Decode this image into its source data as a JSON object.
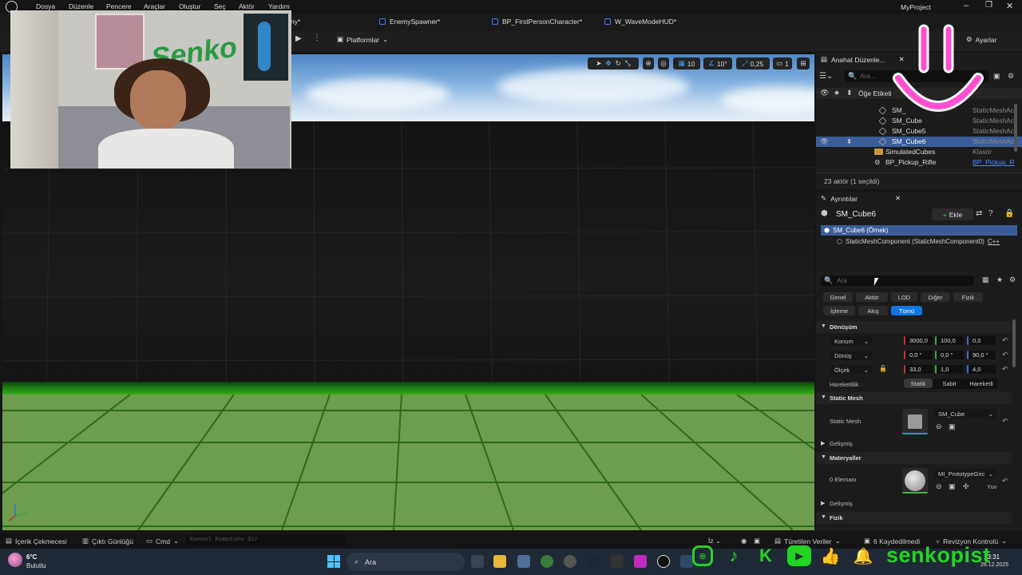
{
  "menu": {
    "items": [
      "Dosya",
      "Düzenle",
      "Pencere",
      "Araçlar",
      "Oluştur",
      "Seç",
      "Aktör",
      "Yardım"
    ],
    "project_name": "MyProject"
  },
  "tabs": [
    {
      "label": "EnemySpawner*"
    },
    {
      "label": "BP_FirstPersonCharacter*"
    },
    {
      "label": "W_WaveModeHUD*"
    },
    {
      "label": "ny*"
    }
  ],
  "toolbar": {
    "platforms_label": "Platformlar",
    "settings_label": "Ayarlar"
  },
  "viewport_tools": {
    "grid_snap": "10",
    "angle_snap": "10°",
    "scale_snap": "0,25",
    "camera_speed": "1"
  },
  "outliner": {
    "tab_label": "Anahat Düzenle...",
    "search_placeholder": "Ara...",
    "column_label": "Öğe Etiketi",
    "rows": [
      {
        "name": "SM_",
        "type": "StaticMeshAc",
        "selected": false,
        "kind": "mesh"
      },
      {
        "name": "SM_Cube",
        "type": "StaticMeshAc",
        "selected": false,
        "kind": "mesh"
      },
      {
        "name": "SM_Cube5",
        "type": "StaticMeshAc",
        "selected": false,
        "kind": "mesh"
      },
      {
        "name": "SM_Cube6",
        "type": "StaticMeshAc",
        "selected": true,
        "kind": "mesh"
      },
      {
        "name": "SimulatedCubes",
        "type": "Klasör",
        "selected": false,
        "kind": "folder"
      },
      {
        "name": "BP_Pickup_Rifle",
        "type": "BP_Pickup_R",
        "selected": false,
        "kind": "bp"
      }
    ],
    "status": "23 aktör (1 seçildi)"
  },
  "details": {
    "tab_label": "Ayrıntılar",
    "actor_name": "SM_Cube6",
    "add_label": "Ekle",
    "instance_label": "SM_Cube6 (Örnek)",
    "component_label": "StaticMeshComponent (StaticMeshComponent0)",
    "component_lang": "C++",
    "search_placeholder": "Ara",
    "categories_row1": [
      "Genel",
      "Aktör",
      "LOD",
      "Diğer",
      "Fizik"
    ],
    "categories_row2": [
      "İşleme",
      "Akış",
      "Tümü"
    ],
    "transform_section": "Dönüşüm",
    "location_label": "Konum",
    "location": [
      "3000,0",
      "100,0",
      "0,0"
    ],
    "rotation_label": "Dönüş",
    "rotation": [
      "0,0 °",
      "0,0 °",
      "90,0 °"
    ],
    "scale_label": "Ölçek",
    "scale": [
      "33,0",
      "1,0",
      "4,0"
    ],
    "mobility_label": "Hareketlilik",
    "mobility": [
      "Statik",
      "Sabit",
      "Hareketli"
    ],
    "static_mesh_section": "Static Mesh",
    "static_mesh_label": "Static Mesh",
    "static_mesh_value": "SM_Cube",
    "advanced_label": "Gelişmiş",
    "materials_section": "Materyaller",
    "elements_label": "0 Elemanı",
    "material_value": "MI_PrototypeGric",
    "material_extra": "Yuv",
    "advanced_label_2": "Gelişmiş",
    "physics_section": "Fizik"
  },
  "bottom_bar": {
    "content_drawer": "İçerik Çekmecesi",
    "output_log": "Çıktı Günlüğü",
    "cmd": "Cmd",
    "console_placeholder": "Konsol Komutunu Gir",
    "derived_data": "Türetilen Veriler",
    "saved": "6 Kaydedilmedi",
    "revision": "Revizyon Kontrolü"
  },
  "taskbar": {
    "weather_temp": "6°C",
    "weather_desc": "Bulutlu",
    "search_label": "Ara",
    "time": "13:31",
    "date": "28.12.2025"
  },
  "stream": {
    "username": "senkopist",
    "poster_text": "Senko"
  },
  "colors": {
    "accent_blue": "#0e76e6",
    "selection": "#3a5d9a",
    "overlay_pink": "#ff4fd2",
    "social_green": "#24d422"
  }
}
